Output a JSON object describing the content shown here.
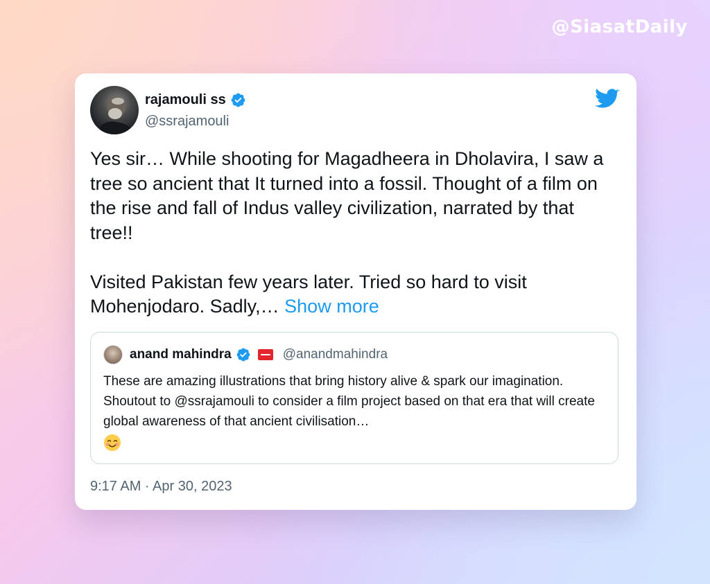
{
  "watermark": "@SiasatDaily",
  "tweet": {
    "author_name": "rajamouli ss",
    "author_handle": "@ssrajamouli",
    "paragraph1": "Yes sir… While shooting for Magadheera in Dholavira, I saw a tree so ancient that It turned into a fossil. Thought of a film on the rise and fall of Indus valley civilization, narrated by that tree!!",
    "paragraph2": "Visited Pakistan few years later. Tried so hard to visit Mohenjodaro. Sadly,… ",
    "show_more": "Show more",
    "timestamp": "9:17 AM · Apr 30, 2023"
  },
  "quoted_tweet": {
    "author_name": "anand mahindra",
    "author_handle": "@anandmahindra",
    "text": "These are amazing illustrations that bring history alive & spark our imagination.  Shoutout to @ssrajamouli to consider a film project based on that era that will create global awareness of that ancient civilisation…"
  },
  "icons": {
    "verified": "verified-badge-icon",
    "twitter": "twitter-bird-icon",
    "emoji": "smiling-face-icon"
  },
  "colors": {
    "accent": "#1d9bf0",
    "text": "#0f1419",
    "muted": "#536471"
  }
}
